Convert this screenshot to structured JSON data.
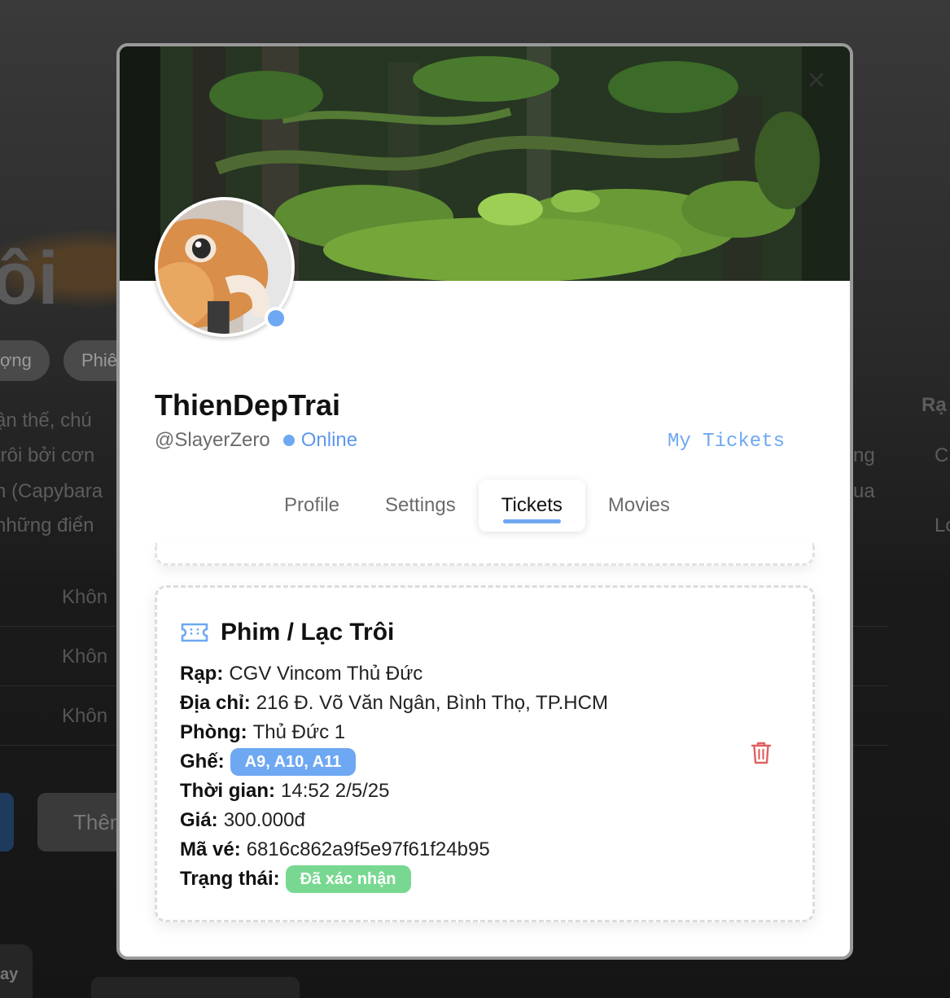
{
  "background": {
    "title_fragment": "ôi",
    "chips": [
      "ợng",
      "Phiê"
    ],
    "desc_lines": [
      "ận thế, chú",
      " trôi bởi cơn",
      "n (Capybara",
      "những điển"
    ],
    "right_heading": "Rạ",
    "right_lines": [
      "ng",
      "ua",
      "C",
      "Lo"
    ],
    "list_items": [
      "Khôn",
      "Khôn",
      "Khôn"
    ],
    "button_label": "Thên",
    "bottom_card_label": "ay"
  },
  "profile": {
    "display_name": "ThienDepTrai",
    "handle": "@SlayerZero",
    "status": "Online",
    "my_tickets_link": "My Tickets"
  },
  "tabs": [
    {
      "label": "Profile",
      "active": false
    },
    {
      "label": "Settings",
      "active": false
    },
    {
      "label": "Tickets",
      "active": true
    },
    {
      "label": "Movies",
      "active": false
    }
  ],
  "ticket": {
    "title": "Phim / Lạc Trôi",
    "fields": {
      "cinema_label": "Rạp:",
      "cinema": "CGV Vincom Thủ Đức",
      "address_label": "Địa chỉ:",
      "address": "216 Đ. Võ Văn Ngân, Bình Thọ, TP.HCM",
      "room_label": "Phòng:",
      "room": "Thủ Đức 1",
      "seats_label": "Ghế:",
      "seats": "A9, A10, A11",
      "time_label": "Thời gian:",
      "time": "14:52 2/5/25",
      "price_label": "Giá:",
      "price": "300.000đ",
      "code_label": "Mã vé:",
      "code": "6816c862a9f5e97f61f24b95",
      "status_label": "Trạng thái:",
      "status": "Đã xác nhận"
    }
  },
  "colors": {
    "accent": "#6ea8f2",
    "confirmed": "#78d891",
    "delete": "#e06060"
  },
  "icons": {
    "close": "close-icon",
    "ticket": "ticket-icon",
    "delete": "trash-icon"
  }
}
